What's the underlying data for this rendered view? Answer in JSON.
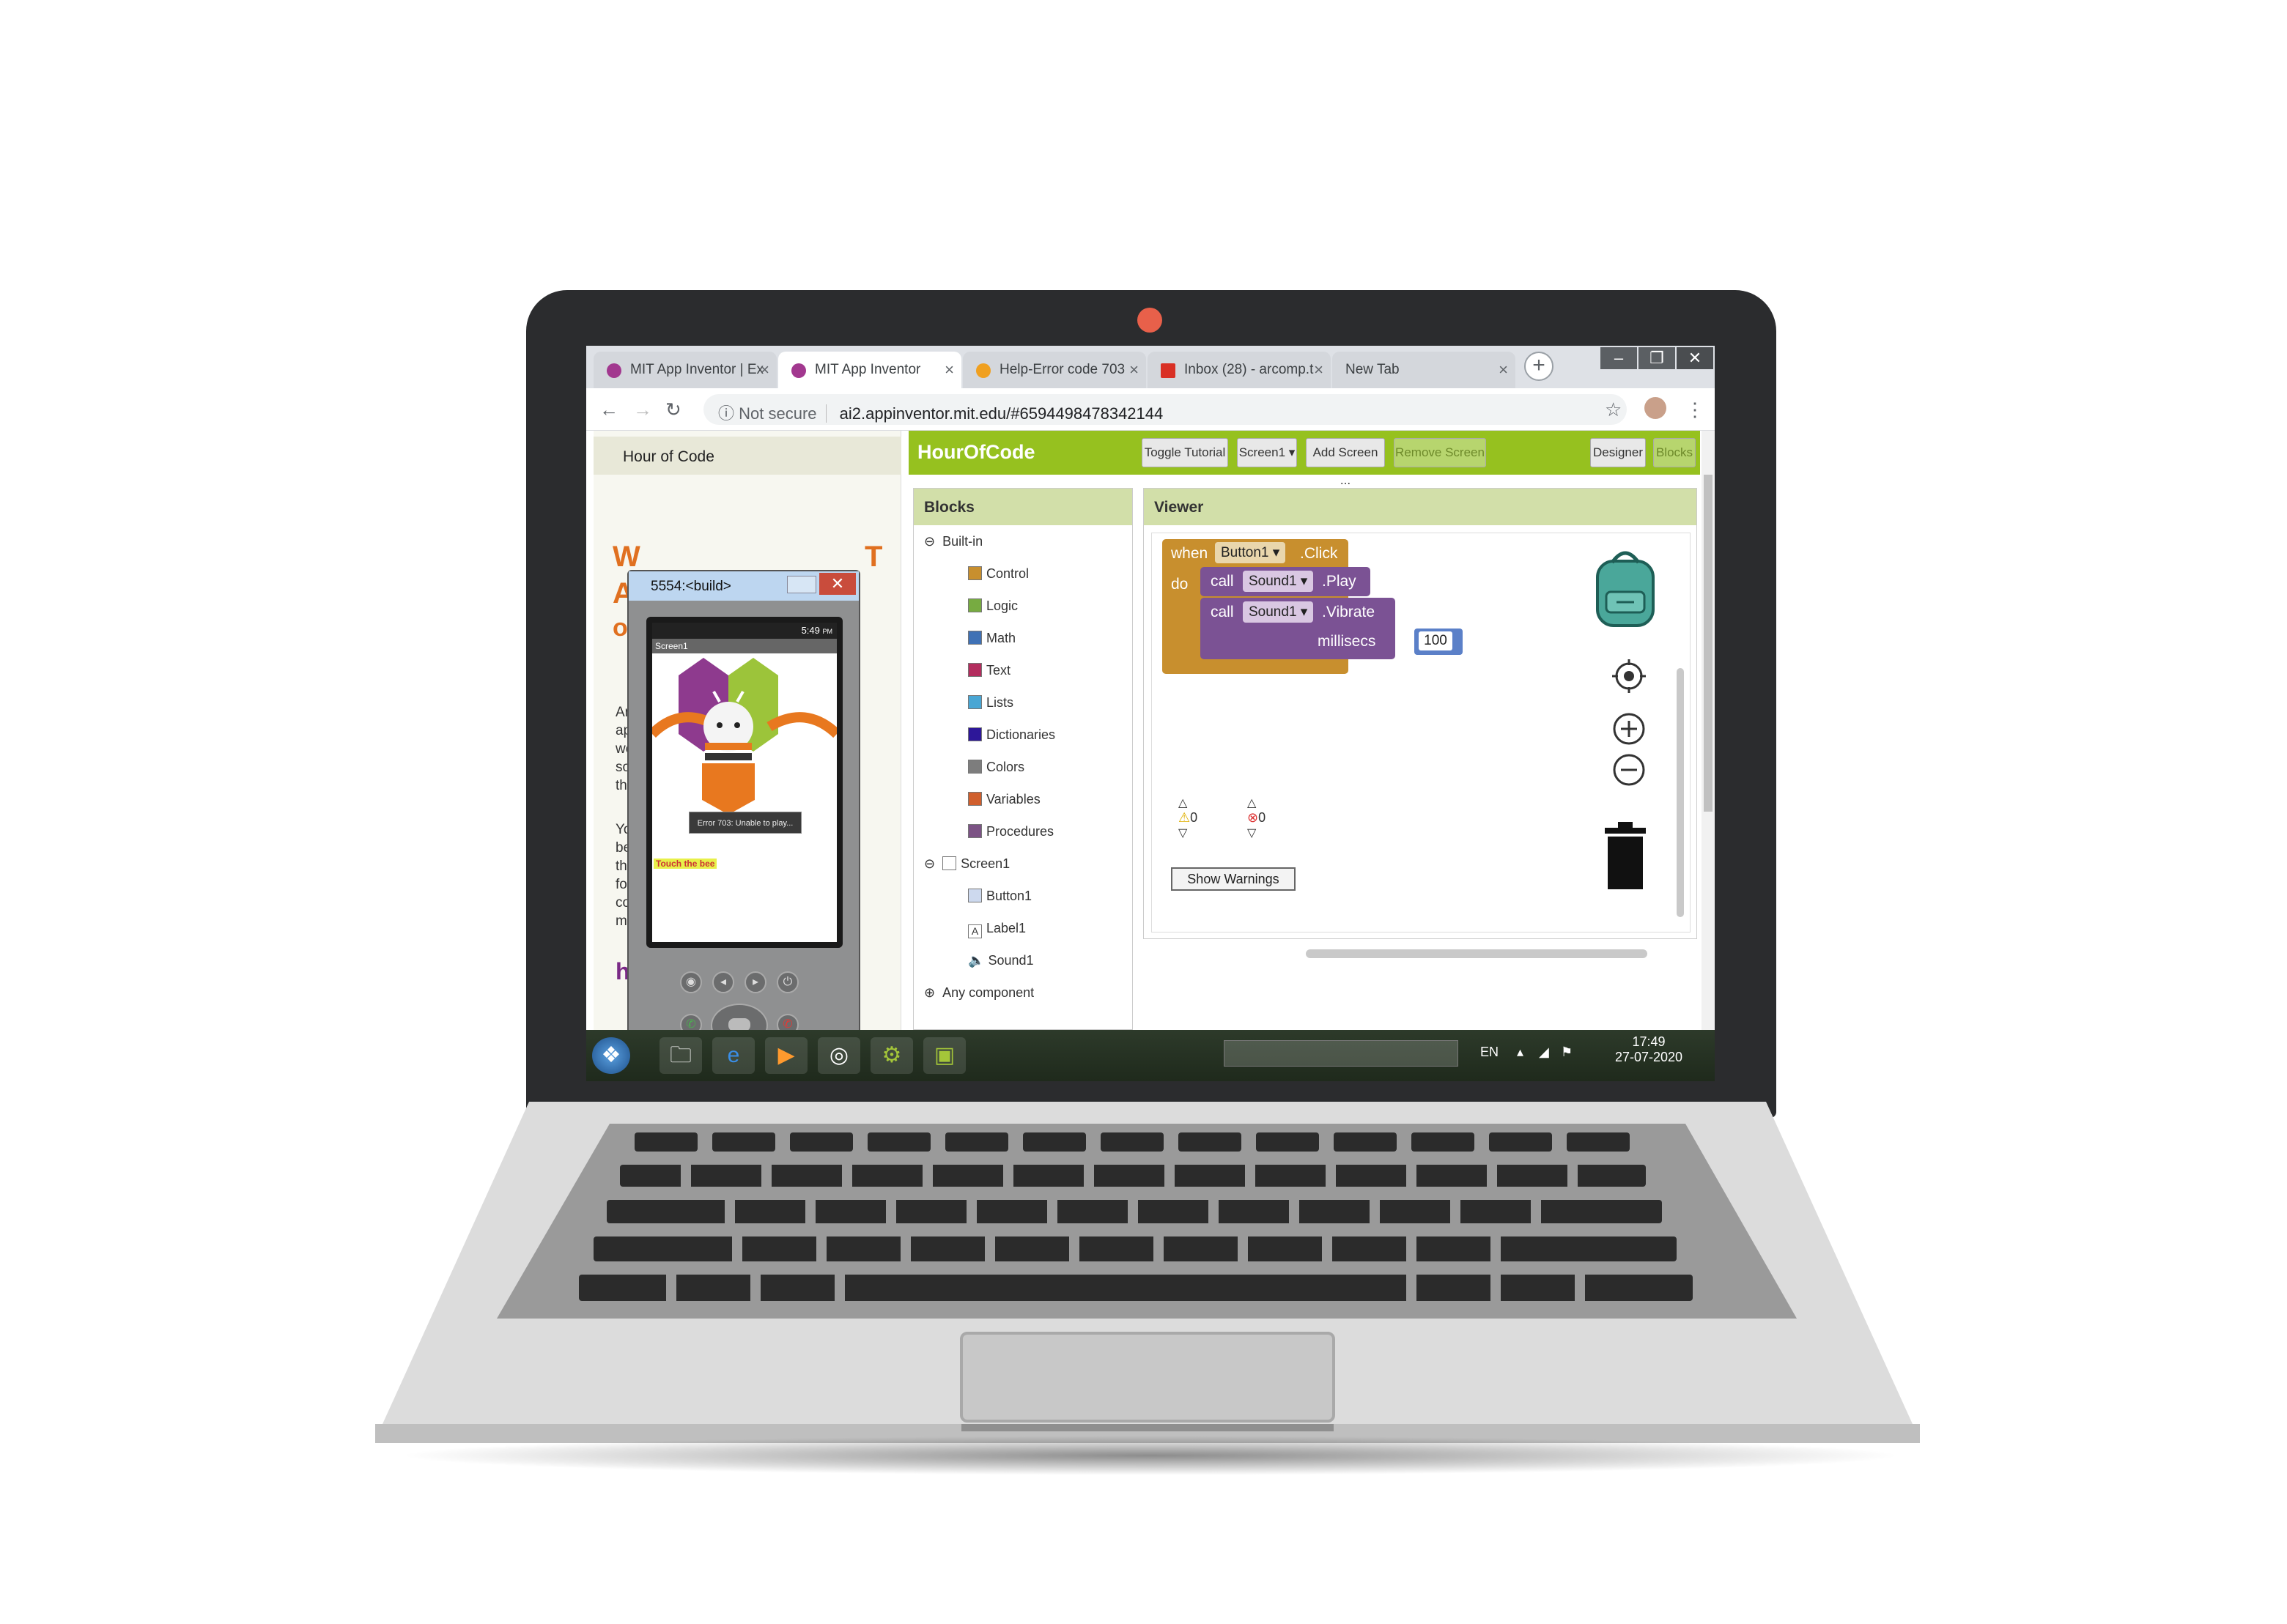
{
  "browser": {
    "tabs": [
      {
        "label": "MIT App Inventor | Ex",
        "active": false,
        "icon_color": "#a2388f"
      },
      {
        "label": "MIT App Inventor",
        "active": true,
        "icon_color": "#a2388f"
      },
      {
        "label": "Help-Error code 703",
        "active": false,
        "icon_color": "#f0a020"
      },
      {
        "label": "Inbox (28) - arcomp.t",
        "active": false,
        "icon_color": "#d93025"
      },
      {
        "label": "New Tab",
        "active": false,
        "icon_color": ""
      }
    ],
    "security_label": "Not secure",
    "url": "ai2.appinventor.mit.edu/#6594498478342144"
  },
  "tutorial": {
    "header": "Hour of Code",
    "link_fragment": "ht"
  },
  "appbar": {
    "project_name": "HourOfCode",
    "toggle_tutorial": "Toggle Tutorial",
    "screen_select": "Screen1 ▾",
    "add_screen": "Add Screen ...",
    "remove_screen": "Remove Screen",
    "designer": "Designer",
    "blocks": "Blocks",
    "accent_color": "#96c11f"
  },
  "blocks_panel": {
    "title": "Blocks",
    "builtin_label": "Built-in",
    "builtin_items": [
      {
        "label": "Control",
        "color": "#c88f2e"
      },
      {
        "label": "Logic",
        "color": "#77ab41"
      },
      {
        "label": "Math",
        "color": "#3f71b5"
      },
      {
        "label": "Text",
        "color": "#b32d5e"
      },
      {
        "label": "Lists",
        "color": "#49a6d4"
      },
      {
        "label": "Dictionaries",
        "color": "#2d1799"
      },
      {
        "label": "Colors",
        "color": "#7d7d7d"
      },
      {
        "label": "Variables",
        "color": "#d05f2d"
      },
      {
        "label": "Procedures",
        "color": "#7c5385"
      }
    ],
    "screen_label": "Screen1",
    "components": [
      "Button1",
      "Label1",
      "Sound1"
    ],
    "any_component": "Any component"
  },
  "viewer": {
    "title": "Viewer",
    "event_when": "when",
    "event_component": "Button1 ▾",
    "event_name": ".Click",
    "do_label": "do",
    "call1": {
      "call": "call",
      "component": "Sound1 ▾",
      "method": ".Play"
    },
    "call2": {
      "call": "call",
      "component": "Sound1 ▾",
      "method": ".Vibrate",
      "param": "millisecs",
      "value": "100"
    },
    "warnings_count": "0",
    "errors_count": "0",
    "show_warnings": "Show Warnings"
  },
  "emulator": {
    "title": "5554:<build>",
    "time": "5:49",
    "time_suffix": "PM",
    "app_title": "Screen1",
    "toast": "Error 703: Unable to play...",
    "label_text": "Touch the bee"
  },
  "taskbar": {
    "lang": "EN",
    "time": "17:49",
    "date": "27-07-2020"
  }
}
